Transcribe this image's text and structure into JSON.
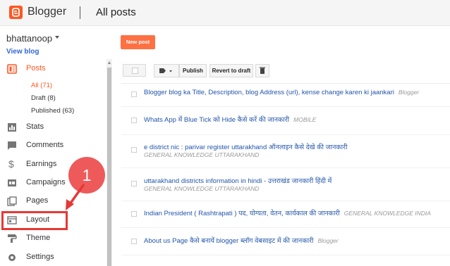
{
  "header": {
    "logo_text": "Blogger",
    "title": "All posts",
    "brand_color": "#ff5722"
  },
  "sidebar": {
    "blog_name": "bhattanoop",
    "view_blog": "View blog",
    "items": [
      {
        "label": "Posts",
        "icon": "posts-icon"
      },
      {
        "label": "Stats",
        "icon": "stats-icon"
      },
      {
        "label": "Comments",
        "icon": "comments-icon"
      },
      {
        "label": "Earnings",
        "icon": "earnings-icon"
      },
      {
        "label": "Campaigns",
        "icon": "campaigns-icon"
      },
      {
        "label": "Pages",
        "icon": "pages-icon"
      },
      {
        "label": "Layout",
        "icon": "layout-icon"
      },
      {
        "label": "Theme",
        "icon": "theme-icon"
      },
      {
        "label": "Settings",
        "icon": "settings-icon"
      }
    ],
    "posts_sub": [
      {
        "label": "All (71)"
      },
      {
        "label": "Draft (8)"
      },
      {
        "label": "Published (63)"
      }
    ]
  },
  "toolbar": {
    "new_post": "New post",
    "label_icon": "label-icon",
    "publish": "Publish",
    "revert": "Revert to draft",
    "delete_icon": "trash-icon"
  },
  "posts": [
    {
      "title": "Blogger blog ka Title, Description, blog Address (url), kense change karen ki jaankari",
      "label": "Blogger"
    },
    {
      "title": "Whats App में Blue Tick को Hide कैसे करें की जानकारी",
      "label": "MOBILE"
    },
    {
      "title": "e district nic : parivar register uttarakhand ऑनलाइन कैसे देखे की जानकारी",
      "label": "GENERAL KNOWLEDGE UTTARAKHAND"
    },
    {
      "title": "uttarakhand districts information in hindi - उत्तराखंड जानकारी हिंदी में",
      "label": "GENERAL KNOWLEDGE UTTARAKHAND"
    },
    {
      "title": "Indian President ( Rashtrapati ) पद, योग्यता, वेतन, कार्यकाल की जानकारी",
      "label": "GENERAL KNOWLEDGE INDIA"
    },
    {
      "title": "About us Page कैसे बनायें blogger ब्लॉग वेबसाइट में की जानकारी",
      "label": "Blogger"
    }
  ],
  "annotation": {
    "callout_number": "1",
    "accent": "#e53935"
  }
}
